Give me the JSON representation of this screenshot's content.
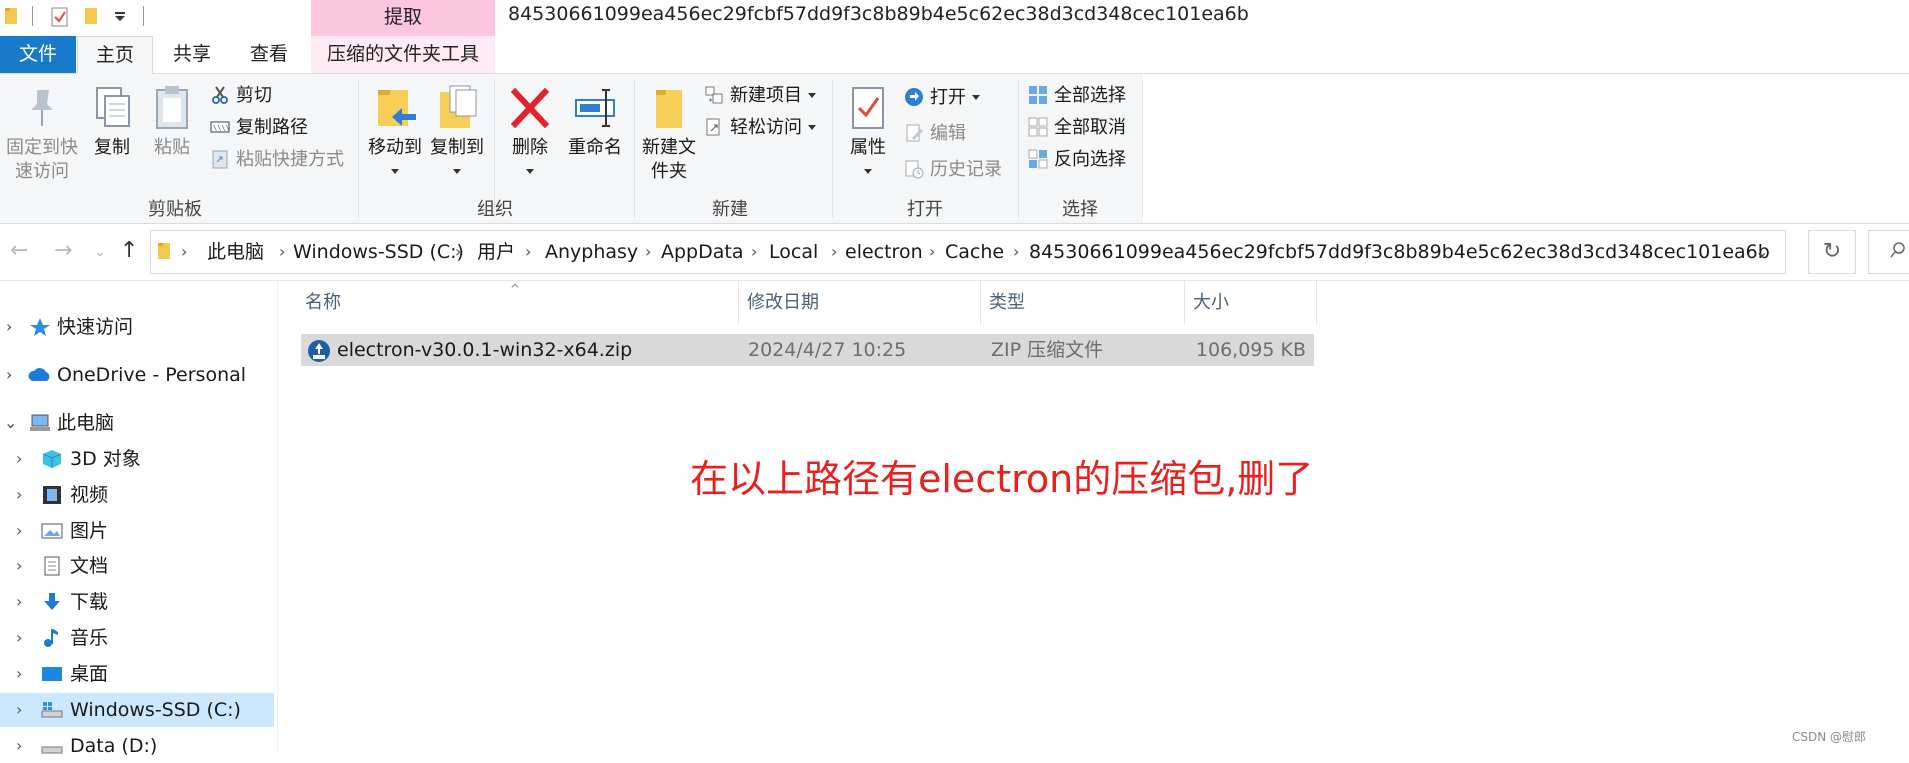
{
  "window": {
    "title": "84530661099ea456ec29fcbf57dd9f3c8b89b4e5c62ec38d3cd348cec101ea6b",
    "context_header": "提取"
  },
  "tabs": {
    "file": "文件",
    "home": "主页",
    "share": "共享",
    "view": "查看",
    "compressed_tools": "压缩的文件夹工具"
  },
  "ribbon": {
    "clipboard": {
      "group_label": "剪贴板",
      "pin_quick_access": "固定到快速访问",
      "copy": "复制",
      "paste": "粘贴",
      "cut": "剪切",
      "copy_path": "复制路径",
      "paste_shortcut": "粘贴快捷方式"
    },
    "organize": {
      "group_label": "组织",
      "move_to": "移动到",
      "copy_to": "复制到",
      "delete": "删除",
      "rename": "重命名"
    },
    "new": {
      "group_label": "新建",
      "new_folder": "新建文件夹",
      "new_item": "新建项目",
      "easy_access": "轻松访问"
    },
    "open": {
      "group_label": "打开",
      "properties": "属性",
      "open": "打开",
      "edit": "编辑",
      "history": "历史记录"
    },
    "select": {
      "group_label": "选择",
      "select_all": "全部选择",
      "select_none": "全部取消",
      "invert_selection": "反向选择"
    }
  },
  "address_bar": {
    "crumbs": [
      "此电脑",
      "Windows-SSD (C:)",
      "用户",
      "Anyphasy",
      "AppData",
      "Local",
      "electron",
      "Cache",
      "84530661099ea456ec29fcbf57dd9f3c8b89b4e5c62ec38d3cd348cec101ea6b"
    ]
  },
  "nav_pane": {
    "items": [
      {
        "label": "快速访问"
      },
      {
        "label": "OneDrive - Personal"
      },
      {
        "label": "此电脑"
      },
      {
        "label": "3D 对象"
      },
      {
        "label": "视频"
      },
      {
        "label": "图片"
      },
      {
        "label": "文档"
      },
      {
        "label": "下载"
      },
      {
        "label": "音乐"
      },
      {
        "label": "桌面"
      },
      {
        "label": "Windows-SSD (C:)"
      },
      {
        "label": "Data (D:)"
      }
    ]
  },
  "file_list": {
    "columns": [
      "名称",
      "修改日期",
      "类型",
      "大小"
    ],
    "rows": [
      {
        "name": "electron-v30.0.1-win32-x64.zip",
        "modified": "2024/4/27 10:25",
        "type": "ZIP 压缩文件",
        "size": "106,095 KB"
      }
    ]
  },
  "annotation": "在以上路径有electron的压缩包,删了",
  "watermark": "CSDN @慰郎",
  "colors": {
    "accent_blue": "#1979ca",
    "context_pink": "#fcc7dc",
    "annotation_red": "#e8201e",
    "selection": "#cce8ff"
  }
}
